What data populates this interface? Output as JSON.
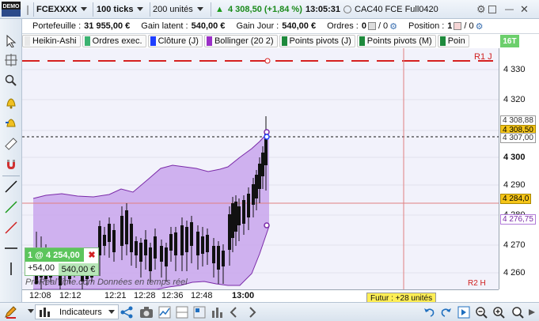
{
  "toolbar": {
    "instrument": "FCEXXXX",
    "period": "100 ticks",
    "units": "200 unités",
    "price_change": "4 308,50 (+1,84 %)",
    "time": "13:05:31",
    "market_name": "CAC40 FCE Full0420",
    "demo_badge": "DEMO"
  },
  "info": {
    "portfolio_label": "Portefeuille :",
    "portfolio_value": "31 955,00 €",
    "unrealized_label": "Gain latent :",
    "unrealized_value": "540,00 €",
    "daily_label": "Gain Jour :",
    "daily_value": "540,00 €",
    "orders_label": "Ordres :",
    "orders_a": "0",
    "orders_b": "/ 0",
    "position_label": "Position :",
    "position_value": "1",
    "position_b": "/ 0",
    "timeframe_badge": "16T"
  },
  "indicators": [
    {
      "label": "Heikin-Ashi",
      "color": "#e8e8e8"
    },
    {
      "label": "Ordres exec.",
      "color": "#3cb371"
    },
    {
      "label": "Clôture (J)",
      "color": "#1f3fff"
    },
    {
      "label": "Bollinger (20 2)",
      "color": "#9b30c8"
    },
    {
      "label": "Points pivots (J)",
      "color": "#1e8a3c"
    },
    {
      "label": "Points pivots (M)",
      "color": "#1e8a3c"
    },
    {
      "label": "Poin",
      "color": "#1e8a3c"
    }
  ],
  "chart": {
    "r1_label": "R1 J",
    "r2_label": "R2 H",
    "watermark": "ProRealTime.com Données en temps réel",
    "position_label": "1 @ 4 254,00",
    "position_points": "+54,00",
    "position_gain": "540,00 €",
    "futures_label": "Futur : +28 unités"
  },
  "price_axis": {
    "ticks": [
      "4 330",
      "4 320",
      "4 310",
      "4 300",
      "4 290",
      "4 280",
      "4 270",
      "4 260"
    ],
    "last_price": "4 308,50",
    "tag_upper": "4 308,88",
    "tag_bb_mid": "4 307,00",
    "tag_entry": "4 284,0",
    "tag_bb_low": "4 276,75"
  },
  "time_axis": {
    "labels": [
      "12:08",
      "12:12",
      "12:21",
      "12:28",
      "12:36",
      "12:48",
      "13:00"
    ]
  },
  "bottom": {
    "indicators_label": "Indicateurs"
  }
}
